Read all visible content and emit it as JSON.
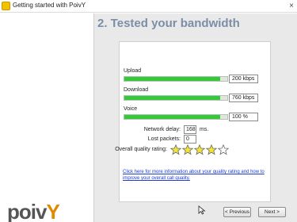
{
  "window": {
    "title": "Getting started with PoivY",
    "close_glyph": "×"
  },
  "logo": {
    "text_main": "poiv",
    "text_accent": "Y"
  },
  "main": {
    "heading": "2. Tested your bandwidth"
  },
  "meters": [
    {
      "label": "Upload",
      "value": "200 kbps",
      "fill": 0.93
    },
    {
      "label": "Download",
      "value": "760 kbps",
      "fill": 0.93
    },
    {
      "label": "Voice",
      "value": "100 %",
      "fill": 0.93
    }
  ],
  "stats": {
    "delay_label": "Network delay:",
    "delay_value": "168",
    "delay_unit": "ms.",
    "lost_label": "Lost packets:",
    "lost_value": "0",
    "rating_label": "Overall quality rating:",
    "rating": 4,
    "rating_max": 5
  },
  "help": {
    "link_text": "Click here for more information about your quality rating and how to improve your overall call quality."
  },
  "buttons": {
    "previous": "< Previous",
    "next": "Next >"
  },
  "colors": {
    "meter_fill": "#33c93a",
    "star_fill": "#f2e23a",
    "heading": "#7b8ea8",
    "link": "#1a3ccf"
  },
  "icons": {
    "app": "poivy-app-icon",
    "star": "star-icon",
    "cursor": "mouse-cursor-icon"
  }
}
